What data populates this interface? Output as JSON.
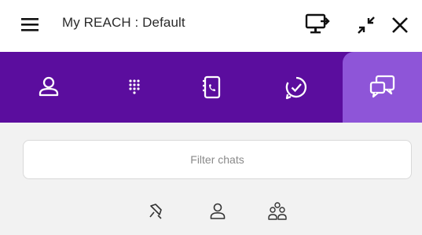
{
  "window": {
    "title": "My REACH : Default",
    "icons": [
      "hamburger-icon",
      "screen-share-icon",
      "minimize-icon",
      "close-icon"
    ]
  },
  "nav": {
    "background": "#5b0d9e",
    "active_background": "#8e55d8",
    "items": [
      {
        "icon": "contact-icon",
        "active": false
      },
      {
        "icon": "dialpad-icon",
        "active": false
      },
      {
        "icon": "phonebook-icon",
        "active": false
      },
      {
        "icon": "status-icon",
        "active": false
      },
      {
        "icon": "chat-icon",
        "active": true
      }
    ]
  },
  "filter": {
    "placeholder": "Filter chats",
    "value": ""
  },
  "chat_filters": [
    {
      "icon": "pin-filter-icon"
    },
    {
      "icon": "single-user-filter-icon"
    },
    {
      "icon": "group-filter-icon"
    }
  ]
}
